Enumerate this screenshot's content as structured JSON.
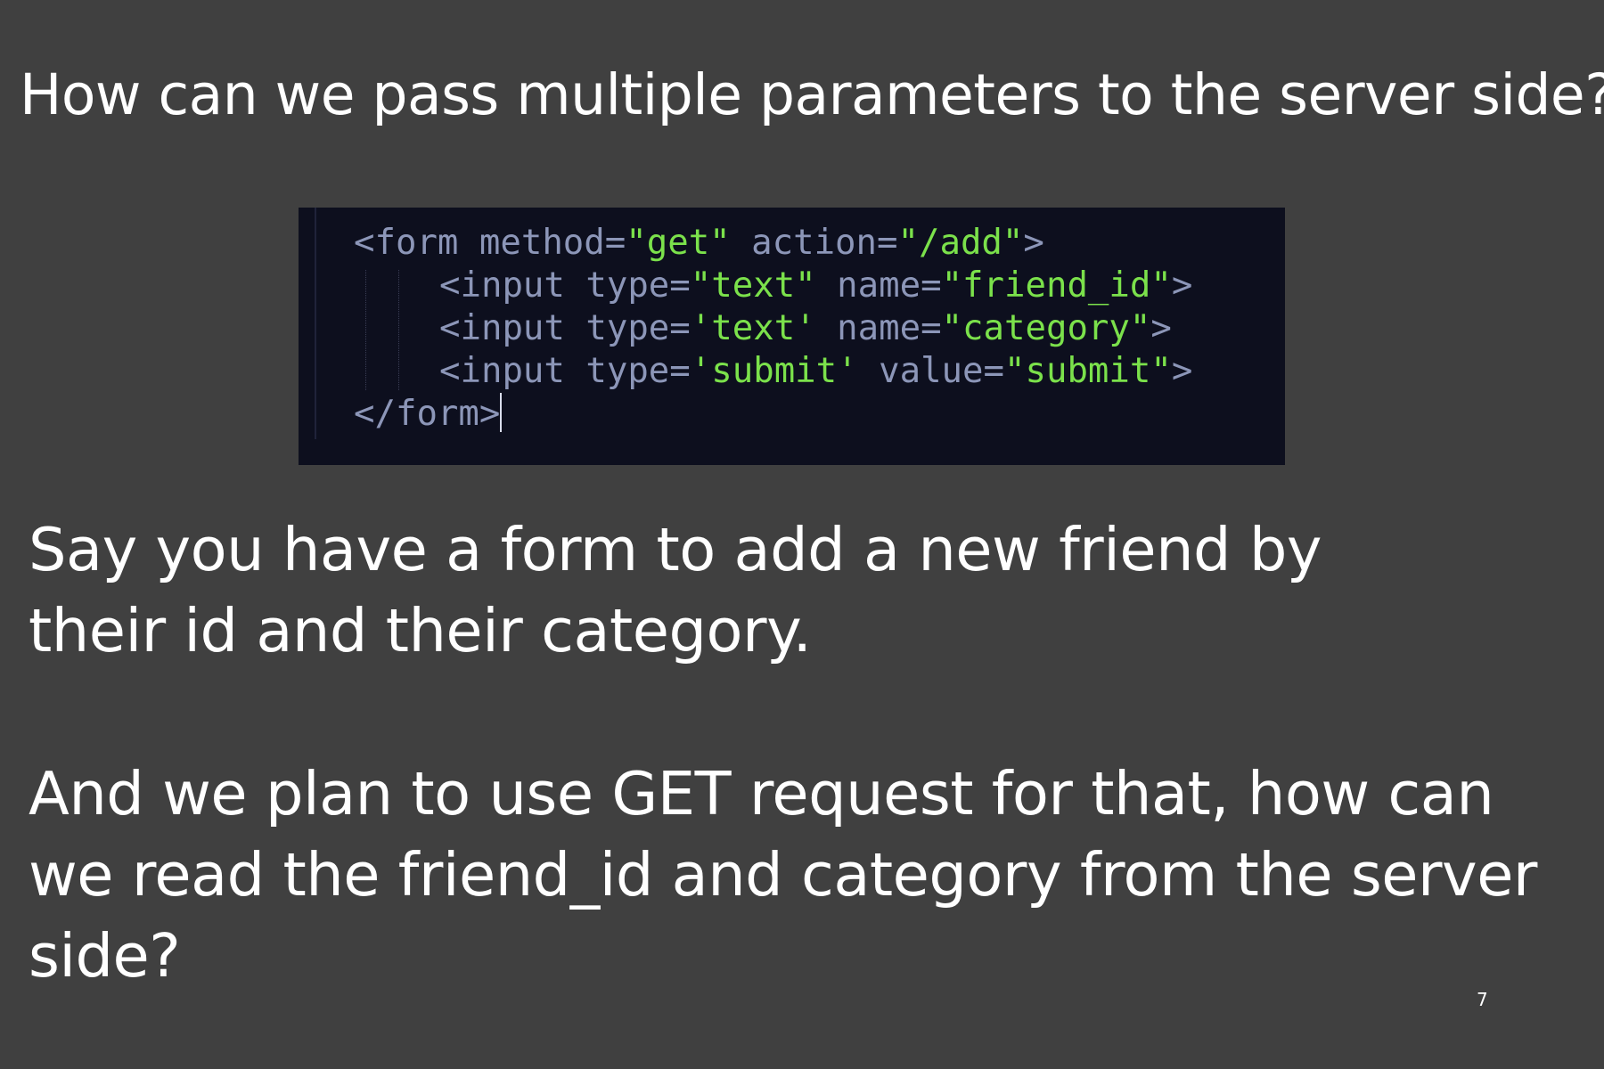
{
  "slide": {
    "title": "How can we pass multiple parameters to the server side?",
    "page_number": "7",
    "background_color": "#404040"
  },
  "code": {
    "lines": [
      {
        "indent": 0,
        "tokens": [
          {
            "kind": "tag",
            "text": "<form"
          },
          {
            "kind": "attr",
            "text": " method="
          },
          {
            "kind": "str",
            "text": "\"get\""
          },
          {
            "kind": "attr",
            "text": " action="
          },
          {
            "kind": "str",
            "text": "\"/add\""
          },
          {
            "kind": "tag",
            "text": ">"
          }
        ]
      },
      {
        "indent": 1,
        "tokens": [
          {
            "kind": "tag",
            "text": "<input"
          },
          {
            "kind": "attr",
            "text": " type="
          },
          {
            "kind": "str",
            "text": "\"text\""
          },
          {
            "kind": "attr",
            "text": " name="
          },
          {
            "kind": "str",
            "text": "\"friend_id\""
          },
          {
            "kind": "tag",
            "text": ">"
          }
        ]
      },
      {
        "indent": 1,
        "tokens": [
          {
            "kind": "tag",
            "text": "<input"
          },
          {
            "kind": "attr",
            "text": " type="
          },
          {
            "kind": "str",
            "text": "'text'"
          },
          {
            "kind": "attr",
            "text": " name="
          },
          {
            "kind": "str",
            "text": "\"category\""
          },
          {
            "kind": "tag",
            "text": ">"
          }
        ]
      },
      {
        "indent": 1,
        "tokens": [
          {
            "kind": "tag",
            "text": "<input"
          },
          {
            "kind": "attr",
            "text": " type="
          },
          {
            "kind": "str",
            "text": "'submit'"
          },
          {
            "kind": "attr",
            "text": " value="
          },
          {
            "kind": "str",
            "text": "\"submit\""
          },
          {
            "kind": "tag",
            "text": ">"
          }
        ]
      },
      {
        "indent": 0,
        "cursor": true,
        "tokens": [
          {
            "kind": "tag",
            "text": "</form>"
          }
        ]
      }
    ],
    "background_color": "#0d0f1e",
    "tag_color": "#8c96b8",
    "string_color": "#7be14b"
  },
  "body": {
    "paragraph_1": {
      "line_1": "Say you have a form to add a new friend by",
      "line_2": "their id and their category."
    },
    "paragraph_2": {
      "line_1": "And we plan to use GET request for that, how can",
      "line_2": "we read the friend_id and category from the server",
      "line_3": "side?"
    }
  }
}
